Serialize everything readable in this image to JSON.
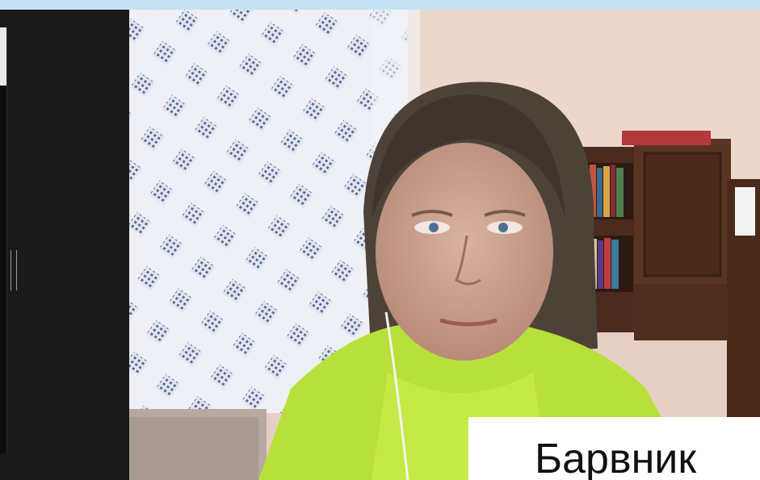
{
  "participant": {
    "name": "Барвник"
  },
  "colors": {
    "top_bar": "#c7e2f4",
    "app_background": "#161616",
    "name_label_background": "#ffffff",
    "name_text": "#111111"
  },
  "icons": {
    "resize_handle": "vertical-double-line"
  }
}
